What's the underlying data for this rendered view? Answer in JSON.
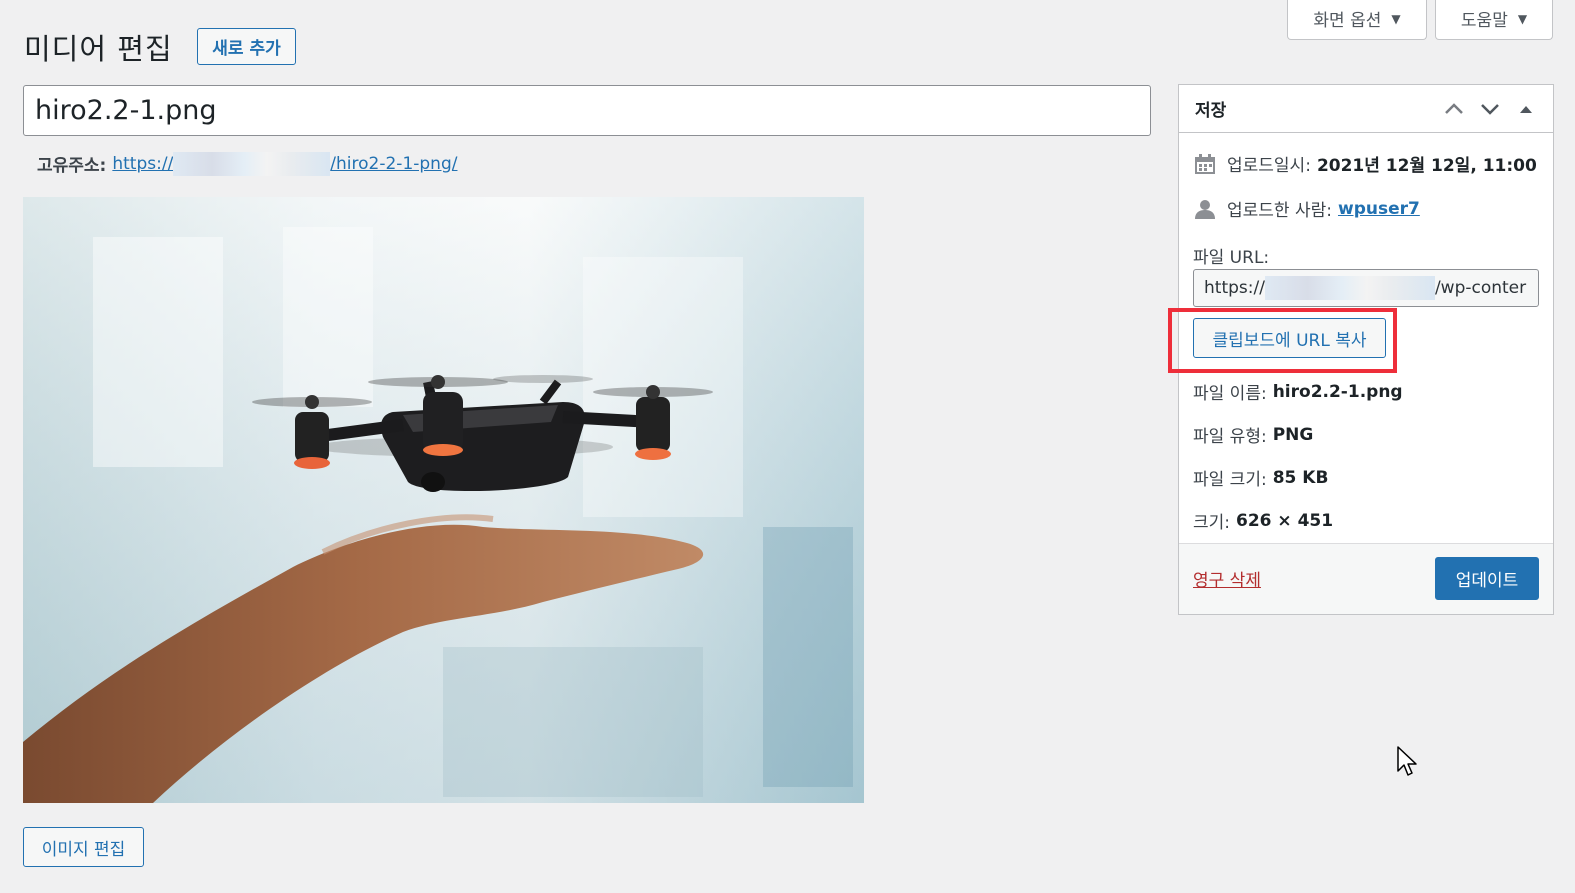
{
  "screen_tabs": {
    "options_label": "화면 옵션",
    "help_label": "도움말",
    "caret": "▼"
  },
  "header": {
    "title": "미디어 편집",
    "add_new_label": "새로 추가"
  },
  "title_field": {
    "value": "hiro2.2-1.png"
  },
  "permalink": {
    "label": "고유주소:",
    "link_start": "https://",
    "link_end": "/hiro2-2-1-png/"
  },
  "image": {
    "alt_icon": "drone-photo"
  },
  "edit_image_label": "이미지 편집",
  "save_box": {
    "title": "저장",
    "uploaded_on_label": "업로드일시:",
    "uploaded_on_value": "2021년 12월 12일, 11:00",
    "uploaded_by_label": "업로드한 사람:",
    "uploaded_by_value": "wpuser7",
    "file_url_label": "파일 URL:",
    "file_url_start": "https://​",
    "file_url_end": "/wp-conter",
    "copy_button_label": "클립보드에 URL 복사",
    "file_name_label": "파일 이름:",
    "file_name_value": "hiro2.2-1.png",
    "file_type_label": "파일 유형:",
    "file_type_value": "PNG",
    "file_size_label": "파일 크기:",
    "file_size_value": "85 KB",
    "dimensions_label": "크기:",
    "dimensions_value": "626 × 451",
    "delete_label": "영구 삭제",
    "update_label": "업데이트"
  },
  "colors": {
    "accent": "#2271b1",
    "delete": "#b32d2e",
    "highlight": "#ee2e3a",
    "background": "#f0f0f1"
  }
}
